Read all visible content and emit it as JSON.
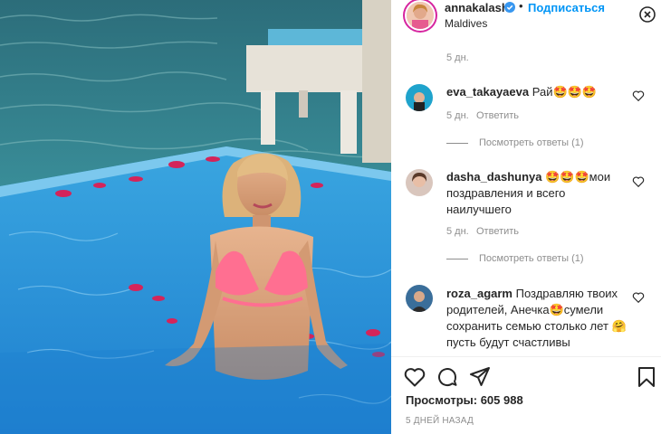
{
  "post": {
    "username": "annakalash",
    "follow_label": "Подписаться",
    "dot": "•",
    "location": "Maldives",
    "views_label": "Просмотры: 605 988",
    "posted_ago": "5 ДНЕЙ НАЗАД"
  },
  "comments": {
    "top_time": "5 дн.",
    "reply_label": "Ответить",
    "items": [
      {
        "user": "eva_takayaeva",
        "text": "Рай🤩🤩🤩",
        "time": "5 дн.",
        "view_replies": "Посмотреть ответы (1)"
      },
      {
        "user": "dasha_dashunya",
        "text": "🤩🤩🤩мои поздравления и всего наилучшего",
        "time": "5 дн.",
        "view_replies": "Посмотреть ответы (1)"
      },
      {
        "user": "roza_agarm",
        "text": "Поздравляю твоих родителей, Анечка🤩сумели сохранить семью столько лет 🤗 пусть будут счастливы"
      }
    ]
  },
  "icons": {
    "verified": "verified-badge-icon",
    "more": "more-options-icon",
    "like": "heart-icon",
    "comment": "comment-bubble-icon",
    "share": "paper-plane-icon",
    "save": "bookmark-icon"
  },
  "colors": {
    "accent": "#0095f6",
    "verified": "#3897f0",
    "text": "#262626",
    "muted": "#8e8e8e"
  }
}
